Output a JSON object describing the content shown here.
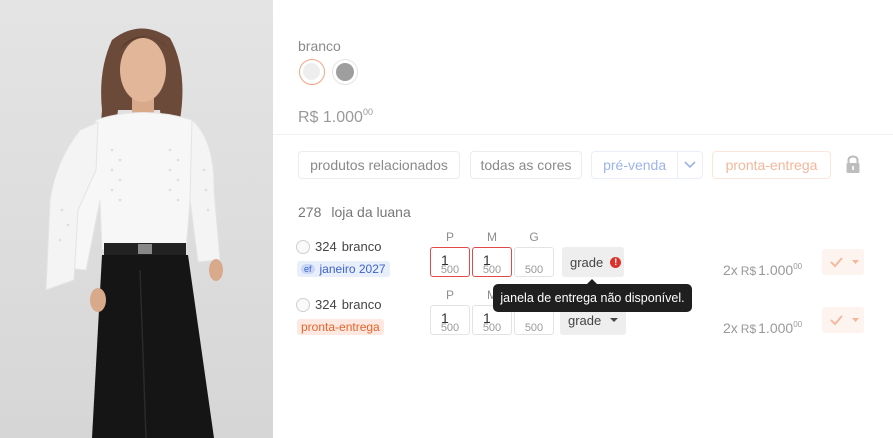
{
  "product": {
    "color_label": "branco",
    "swatches": [
      {
        "name": "branco",
        "hex": "#eeeeee",
        "selected": true
      },
      {
        "name": "cinza",
        "hex": "#9e9e9e",
        "selected": false
      }
    ],
    "price_main": "R$ 1.000",
    "price_cents": "00"
  },
  "filters": {
    "related": "produtos relacionados",
    "all_colors": "todas as cores",
    "pre_sale": "pré-venda",
    "ready": "pronta-entrega"
  },
  "store": {
    "number": "278",
    "name": "loja da luana"
  },
  "sizes": [
    "P",
    "M",
    "G"
  ],
  "rows": [
    {
      "code": "324",
      "color": "branco",
      "tag_prefix": "ef",
      "tag": "janeiro 2027",
      "qty": [
        {
          "value": "1",
          "stock": "500",
          "error": true
        },
        {
          "value": "1",
          "stock": "500",
          "error": true
        },
        {
          "value": "",
          "stock": "500",
          "error": false
        }
      ],
      "grade_label": "grade",
      "alert_glyph": "!",
      "installments": "2x",
      "currency": "R$",
      "amount": "1.000",
      "cents": "00"
    },
    {
      "code": "324",
      "color": "branco",
      "tag": "pronta-entrega",
      "qty": [
        {
          "value": "1",
          "stock": "500",
          "error": false
        },
        {
          "value": "1",
          "stock": "500",
          "error": false
        },
        {
          "value": "",
          "stock": "500",
          "error": false
        }
      ],
      "grade_label": "grade",
      "installments": "2x",
      "currency": "R$",
      "amount": "1.000",
      "cents": "00"
    }
  ],
  "tooltip": "janela de entrega não disponível.",
  "colors": {
    "accent_orange": "#e7622b",
    "accent_blue": "#3c64c8",
    "error_red": "#e24a4a"
  },
  "icons": [
    "lock-icon",
    "chevron-down-icon",
    "check-icon",
    "caret-down-icon",
    "alert-icon"
  ]
}
